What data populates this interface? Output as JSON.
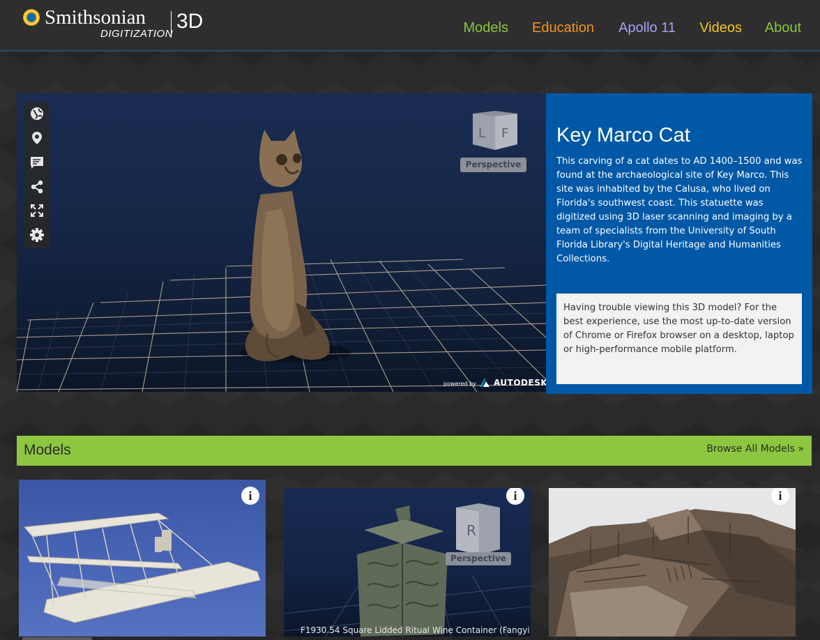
{
  "header": {
    "logo": {
      "name": "Smithsonian",
      "sub": "DIGITIZATION",
      "suffix": "3D"
    },
    "nav": [
      {
        "label": "Models",
        "color": "#8dc63f"
      },
      {
        "label": "Education",
        "color": "#f7941d"
      },
      {
        "label": "Apollo 11",
        "color": "#a3a3f5"
      },
      {
        "label": "Videos",
        "color": "#f7c41d"
      },
      {
        "label": "About",
        "color": "#8dc63f"
      }
    ]
  },
  "viewer": {
    "tools": [
      "globe-icon",
      "location-pin-icon",
      "annotation-icon",
      "share-icon",
      "fullscreen-icon",
      "settings-icon"
    ],
    "cube_faces": [
      "L",
      "F"
    ],
    "perspective_label": "Perspective",
    "powered_by": "powered by",
    "brand": "AUTODESK"
  },
  "featured": {
    "title": "Key Marco Cat",
    "description": "This carving of a cat dates to AD 1400–1500 and was found at the archaeological site of Key Marco. This site was inhabited by the Calusa, who lived on Florida's southwest coast. This statuette was digitized using 3D laser scanning and imaging by a team of specialists from the University of South Florida Library's Digital Heritage and Humanities Collections.",
    "notice": "Having trouble viewing this 3D model? For the best experience, use the most up-to-date version of Chrome or Firefox browser on a desktop, laptop or high-performance mobile platform."
  },
  "models": {
    "title": "Models",
    "browse_label": "Browse All Models »",
    "cards": [
      {
        "info": "i",
        "caption": ""
      },
      {
        "info": "i",
        "caption": "F1930.54 Square Lidded Ritual Wine Container (Fangyi",
        "cube_face": "R",
        "perspective_label": "Perspective"
      },
      {
        "info": "i",
        "caption": ""
      }
    ]
  }
}
